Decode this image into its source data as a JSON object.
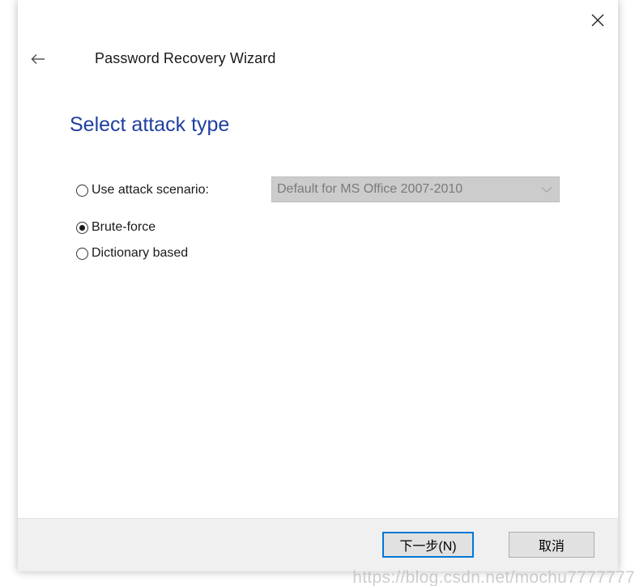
{
  "window": {
    "title": "Password Recovery Wizard",
    "close_icon": "close-icon",
    "back_icon": "arrow-left-icon"
  },
  "page": {
    "heading": "Select attack type",
    "heading_color": "#1f3fa0"
  },
  "options": [
    {
      "label": "Use attack scenario:",
      "selected": false
    },
    {
      "label": "Brute-force",
      "selected": true
    },
    {
      "label": "Dictionary based",
      "selected": false
    }
  ],
  "scenario_select": {
    "value": "Default for MS Office 2007-2010",
    "disabled": true,
    "icon": "chevron-down-icon"
  },
  "footer": {
    "next_label": "下一步(N)",
    "cancel_label": "取消",
    "accent": "#0078d7"
  },
  "watermark": "https://blog.csdn.net/mochu7777777"
}
